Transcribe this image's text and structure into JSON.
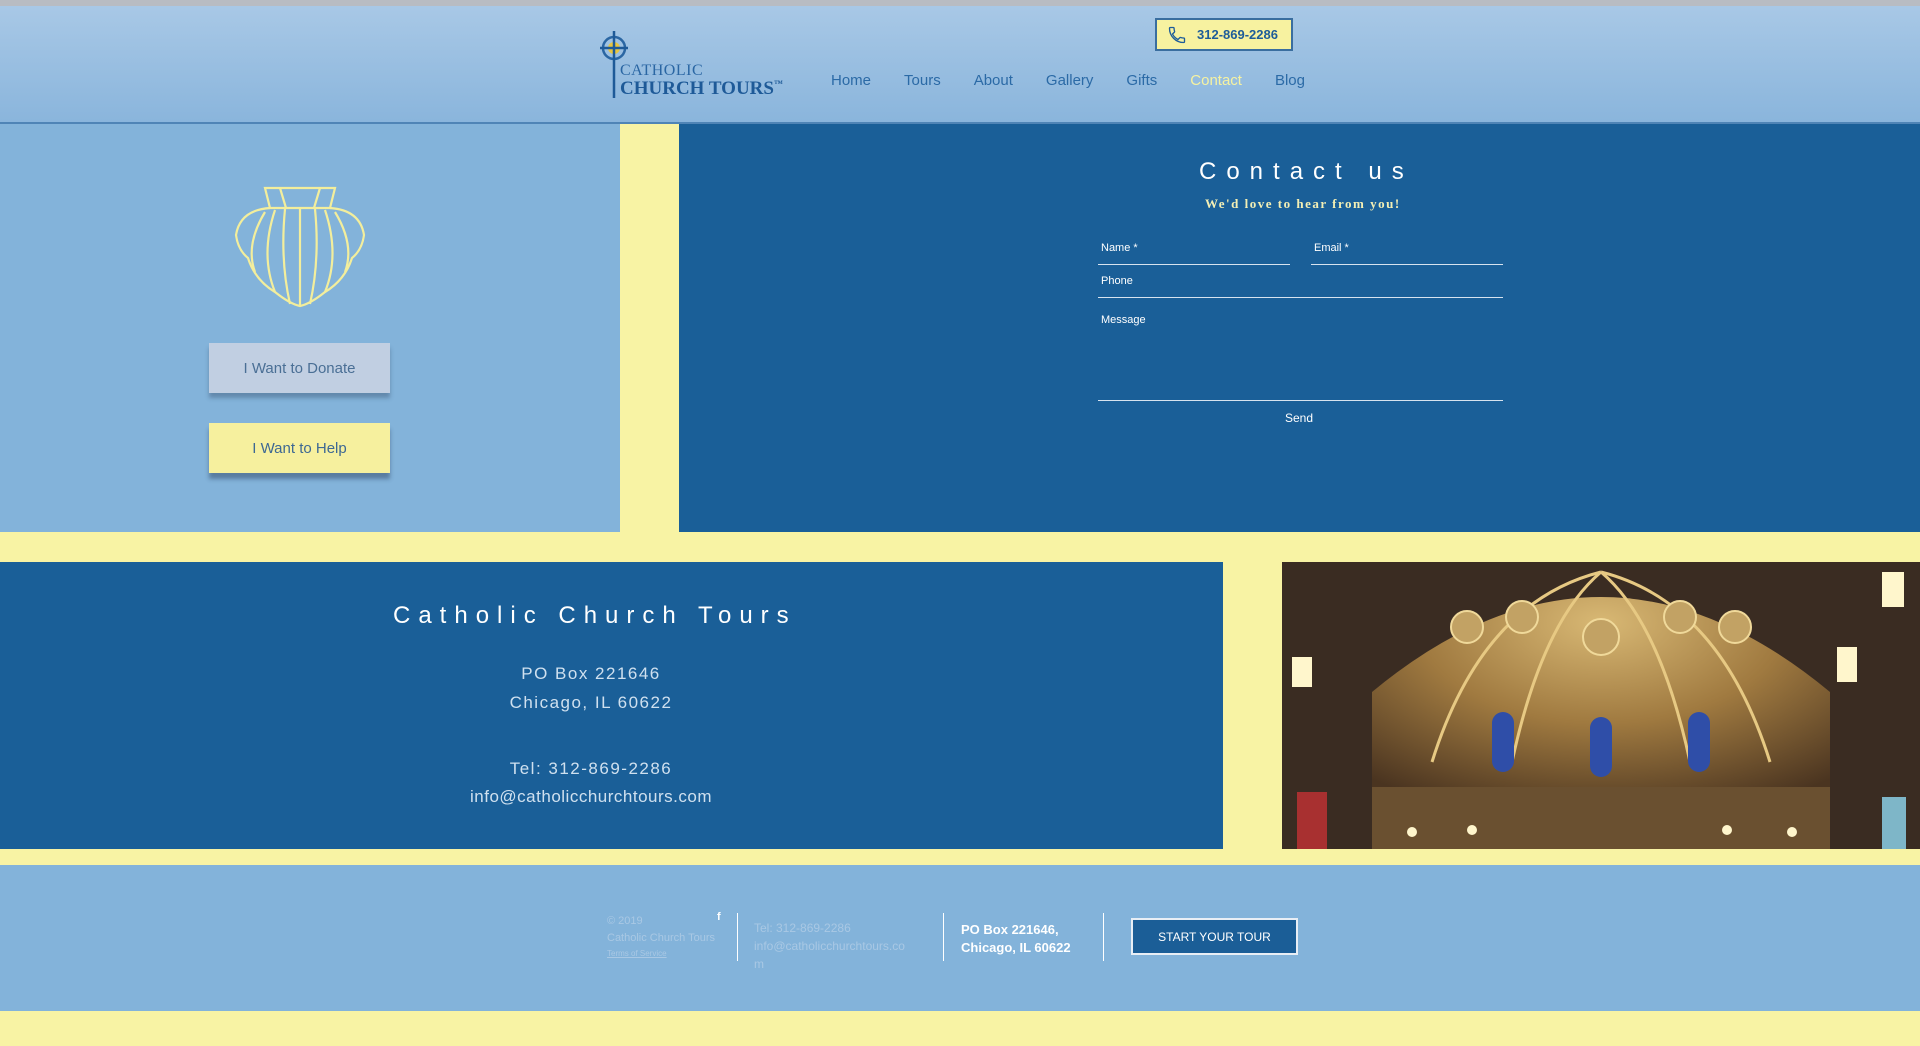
{
  "header": {
    "logo": {
      "line1": "CATHOLIC",
      "line2": "CHURCH TOURS",
      "mark": "™"
    },
    "phone": "312-869-2286",
    "nav": [
      {
        "label": "Home"
      },
      {
        "label": "Tours"
      },
      {
        "label": "About"
      },
      {
        "label": "Gallery"
      },
      {
        "label": "Gifts"
      },
      {
        "label": "Contact",
        "active": true
      },
      {
        "label": "Blog"
      }
    ]
  },
  "left_panel": {
    "donate_label": "I Want to Donate",
    "help_label": "I Want to Help"
  },
  "contact": {
    "title": "Contact us",
    "subtitle": "We'd love to hear from you!",
    "name_label": "Name *",
    "email_label": "Email *",
    "phone_label": "Phone",
    "message_label": "Message",
    "send_label": "Send"
  },
  "info": {
    "title": "Catholic Church Tours",
    "address1": "PO Box 221646",
    "address2": "Chicago, IL 60622",
    "tel": "Tel: 312-869-2286",
    "email": "info@catholicchurchtours.com"
  },
  "footer": {
    "copyright": "© 2019",
    "company": "Catholic Church Tours",
    "terms": "Terms of Service",
    "facebook": "f",
    "tel": "Tel: 312-869-2286",
    "email_line1": "info@catholicchurchtours.co",
    "email_line2": "m",
    "address1": "PO Box 221646,",
    "address2": "Chicago, IL 60622",
    "cta": "START YOUR TOUR"
  },
  "colors": {
    "accent_yellow": "#f8f3a4",
    "panel_blue": "#1a5f98",
    "light_blue": "#83b3da"
  }
}
